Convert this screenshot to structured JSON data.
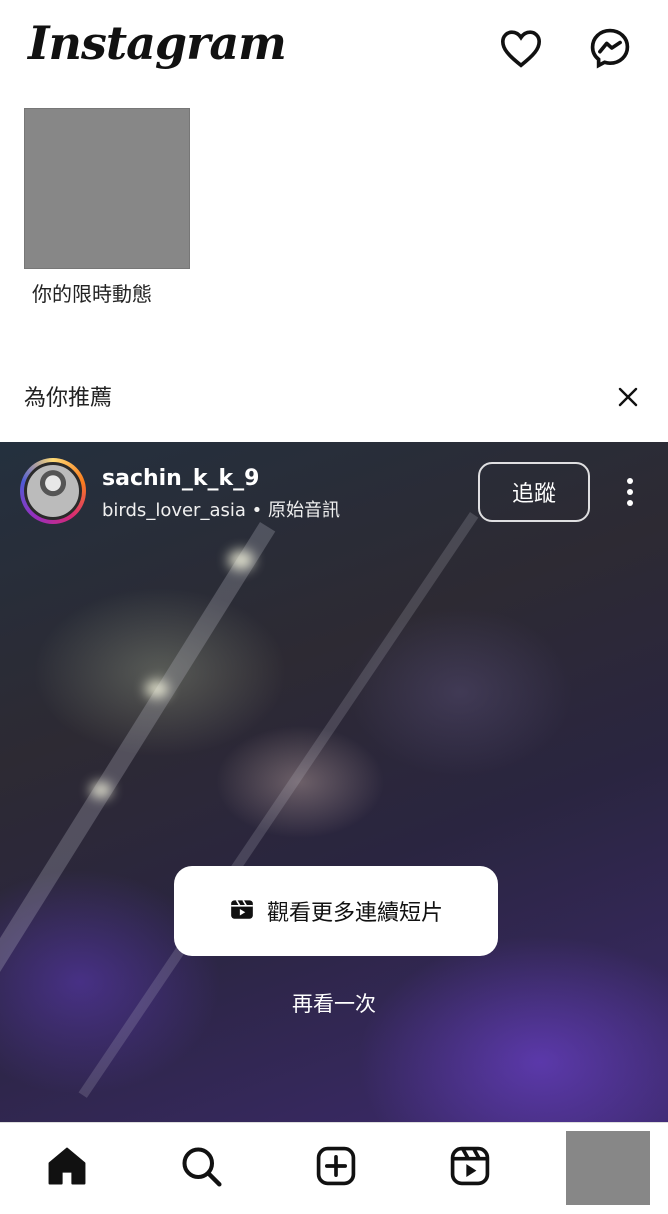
{
  "header": {
    "logo_text": "Instagram",
    "icons": {
      "notifications": "heart-icon",
      "messages": "messenger-icon"
    }
  },
  "story": {
    "label": "你的限時動態"
  },
  "suggestions": {
    "title": "為你推薦",
    "close_icon": "close-icon"
  },
  "reel": {
    "username": "sachin_k_k_9",
    "audio_author": "birds_lover_asia",
    "separator": "•",
    "audio_label": "原始音訊",
    "follow_label": "追蹤",
    "more_icon": "more-vertical-icon",
    "watch_more_label": "觀看更多連續短片",
    "watch_more_icon": "reels-icon",
    "replay_label": "再看一次"
  },
  "nav": {
    "items": [
      "home-icon",
      "search-icon",
      "create-icon",
      "reels-icon",
      "profile-avatar"
    ]
  },
  "colors": {
    "background": "#ffffff",
    "text": "#111111",
    "placeholder": "#878787"
  }
}
